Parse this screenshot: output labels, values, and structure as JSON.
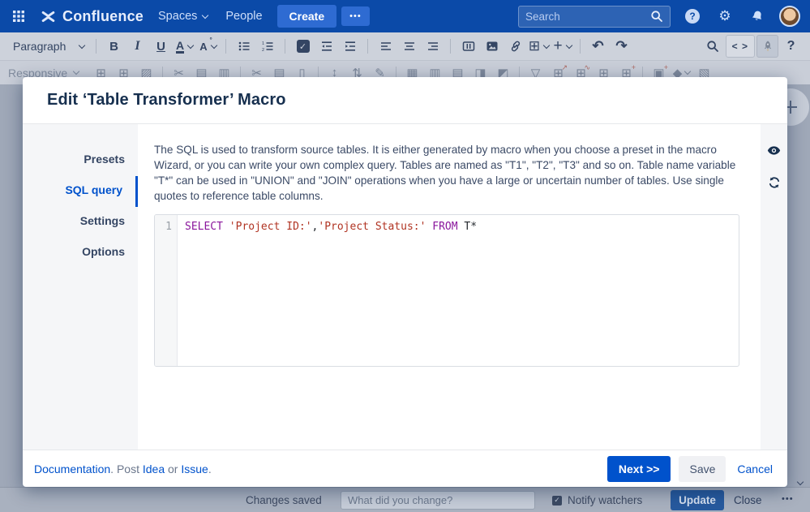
{
  "colors": {
    "nav_bg": "#0b4aa8",
    "accent_blue": "#0052cc",
    "toolbar_icon": "#344563",
    "keyword_purple": "#8a169c",
    "string_red": "#b03322"
  },
  "nav": {
    "brand": "Confluence",
    "spaces_label": "Spaces",
    "people_label": "People",
    "create_label": "Create",
    "more_label": "•••",
    "search_placeholder": "Search",
    "icons": [
      "app-switcher",
      "help",
      "gear",
      "bell",
      "avatar"
    ]
  },
  "toolbar": {
    "paragraph_label": "Paragraph",
    "bold": "B",
    "italic": "I",
    "underline": "U",
    "text_color": "A",
    "more_formatting": "A",
    "code_view_label": "< >",
    "help_label": "?",
    "icons": [
      "bullet-list",
      "numbered-list",
      "task-list",
      "outdent",
      "indent",
      "align-left",
      "align-center",
      "align-right",
      "page-layout",
      "insert-image",
      "insert-link",
      "insert-table",
      "insert-more",
      "undo",
      "redo",
      "find",
      "macros-rocket"
    ]
  },
  "toolbar2": {
    "dropdown_label": "Responsive",
    "icons": [
      {
        "name": "cell-insert-before",
        "glyph": "⊞"
      },
      {
        "name": "cell-insert-after",
        "glyph": "⊞"
      },
      {
        "name": "cell-clear",
        "glyph": "▨"
      },
      {
        "sep": true
      },
      {
        "name": "row-cut",
        "glyph": "✂"
      },
      {
        "name": "row-copy",
        "glyph": "▤"
      },
      {
        "name": "row-paste",
        "glyph": "▥"
      },
      {
        "sep": true
      },
      {
        "name": "column-cut",
        "glyph": "✂"
      },
      {
        "name": "column-copy",
        "glyph": "▤"
      },
      {
        "name": "column-paste",
        "glyph": "▯"
      },
      {
        "sep": true
      },
      {
        "name": "insert-row",
        "glyph": "↕"
      },
      {
        "name": "insert-column",
        "glyph": "⇅"
      },
      {
        "name": "diagonal-line",
        "glyph": "✎"
      },
      {
        "sep": true
      },
      {
        "name": "table-header-row",
        "glyph": "▦"
      },
      {
        "name": "table-header-column",
        "glyph": "▥"
      },
      {
        "name": "table-merge-cells",
        "glyph": "▤"
      },
      {
        "name": "table-split-cells",
        "glyph": "◨"
      },
      {
        "name": "table-corner-cell",
        "glyph": "◩"
      },
      {
        "sep": true
      },
      {
        "name": "table-filter",
        "glyph": "▽"
      },
      {
        "name": "pivot-table",
        "glyph": "⊞",
        "accent": "↗"
      },
      {
        "name": "chart-from-table",
        "glyph": "⊞",
        "accent": "∿"
      },
      {
        "name": "table-transformer",
        "glyph": "⊞"
      },
      {
        "name": "table-plus",
        "glyph": "⊞",
        "accent": "+"
      },
      {
        "sep": true
      },
      {
        "name": "add-macro-case",
        "glyph": "▣",
        "accent": "+"
      },
      {
        "name": "fill-color",
        "glyph": "◆",
        "chevron": true
      },
      {
        "name": "clear-formatting",
        "glyph": "▧"
      }
    ]
  },
  "modal": {
    "title": "Edit ‘Table Transformer’ Macro",
    "sidebar": [
      {
        "label": "Presets",
        "active": false
      },
      {
        "label": "SQL query",
        "active": true
      },
      {
        "label": "Settings",
        "active": false
      },
      {
        "label": "Options",
        "active": false
      }
    ],
    "description": "The SQL is used to transform source tables. It is either generated by macro when you choose a preset in the macro Wizard, or you can write your own complex query. Tables are named as \"T1\", \"T2\", \"T3\" and so on. Table name variable \"T*\" can be used in \"UNION\" and \"JOIN\" operations when you have a large or uncertain number of tables. Use single quotes to reference table columns.",
    "code": {
      "line_number": "1",
      "tokens": [
        {
          "text": "SELECT",
          "type": "keyword"
        },
        {
          "text": " ",
          "type": "plain"
        },
        {
          "text": "'Project ID:'",
          "type": "string"
        },
        {
          "text": ",",
          "type": "plain"
        },
        {
          "text": "'Project Status:'",
          "type": "string"
        },
        {
          "text": " ",
          "type": "plain"
        },
        {
          "text": "FROM",
          "type": "keyword"
        },
        {
          "text": " T*",
          "type": "plain"
        }
      ]
    },
    "rail_icons": [
      "preview-eye",
      "refresh"
    ],
    "footer": {
      "doc_link": "Documentation",
      "post_text": ". Post ",
      "idea_link": "Idea",
      "or_text": " or ",
      "issue_link": "Issue",
      "period": ".",
      "next_button": "Next >>",
      "save_button": "Save",
      "cancel_button": "Cancel"
    }
  },
  "bottom_bar": {
    "status": "Changes saved",
    "comment_placeholder": "What did you change?",
    "notify_label": "Notify watchers",
    "notify_checked": true,
    "update_button": "Update",
    "close_button": "Close",
    "more_label": "•••"
  }
}
